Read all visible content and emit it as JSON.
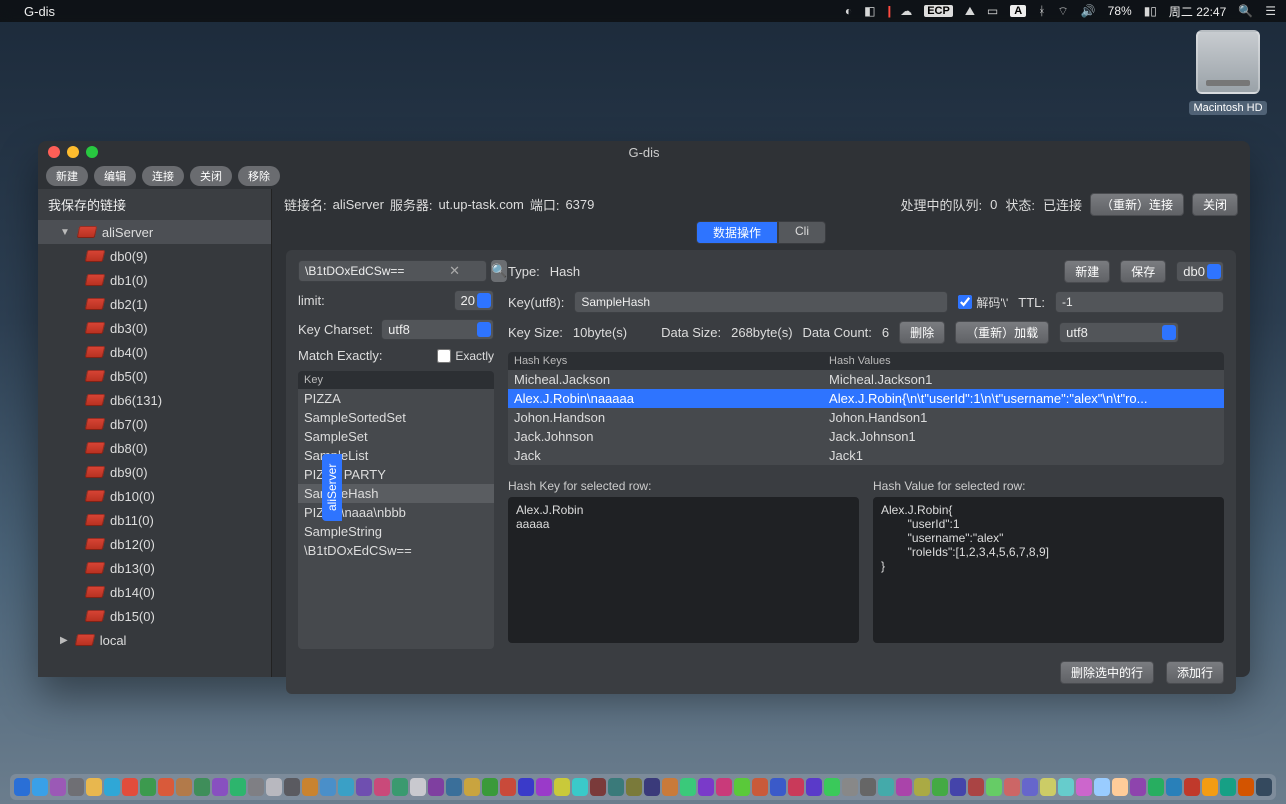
{
  "menubar": {
    "app_name": "G-dis",
    "battery_pct": "78%",
    "clock": "周二 22:47"
  },
  "desktop": {
    "hdd_label": "Macintosh HD"
  },
  "window": {
    "title": "G-dis",
    "toolbar": {
      "new": "新建",
      "edit": "编辑",
      "connect": "连接",
      "close": "关闭",
      "remove": "移除"
    },
    "info": {
      "conn_name_label": "链接名:",
      "conn_name": "aliServer",
      "server_label": "服务器:",
      "server": "ut.up-task.com",
      "port_label": "端口:",
      "port": "6379",
      "queue_label": "处理中的队列:",
      "queue_val": "0",
      "status_label": "状态:",
      "status_val": "已连接",
      "reconnect": "（重新）连接",
      "close": "关闭"
    }
  },
  "sidebar": {
    "header": "我保存的链接",
    "server": "aliServer",
    "local": "local",
    "dbs": [
      {
        "label": "db0(9)"
      },
      {
        "label": "db1(0)"
      },
      {
        "label": "db2(1)"
      },
      {
        "label": "db3(0)"
      },
      {
        "label": "db4(0)"
      },
      {
        "label": "db5(0)"
      },
      {
        "label": "db6(131)"
      },
      {
        "label": "db7(0)"
      },
      {
        "label": "db8(0)"
      },
      {
        "label": "db9(0)"
      },
      {
        "label": "db10(0)"
      },
      {
        "label": "db11(0)"
      },
      {
        "label": "db12(0)"
      },
      {
        "label": "db13(0)"
      },
      {
        "label": "db14(0)"
      },
      {
        "label": "db15(0)"
      }
    ]
  },
  "tabs": {
    "data": "数据操作",
    "cli": "Cli"
  },
  "left_panel": {
    "search_value": "\\B1tDOxEdCSw==",
    "limit_label": "limit:",
    "limit_value": "20",
    "charset_label": "Key Charset:",
    "charset_value": "utf8",
    "match_label": "Match Exactly:",
    "exactly_label": "Exactly",
    "keys_header": "Key",
    "keys": [
      "PIZZA",
      "SampleSortedSet",
      "SampleSet",
      "SampleList",
      "PIZZA PARTY",
      "SampleHash",
      "PIZZA\\naaa\\nbbb",
      "SampleString",
      "\\B1tDOxEdCSw=="
    ],
    "selected_key": "SampleHash"
  },
  "right_panel": {
    "type_label": "Type:",
    "type_value": "Hash",
    "btn_new": "新建",
    "btn_save": "保存",
    "db_sel": "db0",
    "key_label": "Key(utf8):",
    "key_value": "SampleHash",
    "decode_label": "解码'\\'",
    "ttl_label": "TTL:",
    "ttl_value": "-1",
    "size_label": "Key Size:",
    "size_value": "10byte(s)",
    "data_size_label": "Data Size:",
    "data_size_value": "268byte(s)",
    "data_count_label": "Data Count:",
    "data_count_value": "6",
    "btn_delete": "删除",
    "btn_reload": "（重新）加载",
    "enc_sel": "utf8",
    "hash_keys_header": "Hash Keys",
    "hash_values_header": "Hash Values",
    "rows": [
      {
        "k": "Micheal.Jackson",
        "v": "Micheal.Jackson1"
      },
      {
        "k": "Alex.J.Robin\\naaaaa",
        "v": "Alex.J.Robin{\\n\\t\"userId\":1\\n\\t\"username\":\"alex\"\\n\\t\"ro..."
      },
      {
        "k": "Johon.Handson",
        "v": "Johon.Handson1"
      },
      {
        "k": "Jack.Johnson",
        "v": "Jack.Johnson1"
      },
      {
        "k": "Jack",
        "v": "Jack1"
      }
    ],
    "selected_row_index": 1,
    "sel_key_label": "Hash Key for selected row:",
    "sel_val_label": "Hash Value for selected row:",
    "sel_key_text": "Alex.J.Robin\naaaaa",
    "sel_val_text": "Alex.J.Robin{\n        \"userId\":1\n        \"username\":\"alex\"\n        \"roleIds\":[1,2,3,4,5,6,7,8,9]\n}",
    "btn_del_row": "删除选中的行",
    "btn_add_row": "添加行"
  },
  "vtab": "aliServer",
  "dock_colors": [
    "#2a6fd6",
    "#39a0e8",
    "#9b59b6",
    "#6f6f74",
    "#e8b74e",
    "#2fa7d6",
    "#e24c3c",
    "#3c9a4e",
    "#d95a3a",
    "#b27a4a",
    "#3f8e5a",
    "#8850c0",
    "#2db56d",
    "#7f7f84",
    "#b8b8bf",
    "#5a5a60",
    "#c9832f",
    "#4a8fc9",
    "#3aa0c6",
    "#6f4fb0",
    "#c94a7a",
    "#3a9a6f",
    "#c9c9cf",
    "#7f3fa0",
    "#3a6f9a",
    "#c9a43f",
    "#3a9a3a",
    "#c94a3a",
    "#3a3ac9",
    "#9a3ac9",
    "#c9c93a",
    "#3ac9c9",
    "#7a3a3a",
    "#3a7a7a",
    "#7a7a3a",
    "#3a3a7a",
    "#c97a3a",
    "#3ac97a",
    "#7a3ac9",
    "#c93a7a",
    "#5ac93a",
    "#c95a3a",
    "#3a5ac9",
    "#c93a5a",
    "#5a3ac9",
    "#3ac95a",
    "#888",
    "#666",
    "#4aa",
    "#a4a",
    "#aa4",
    "#4a4",
    "#44a",
    "#a44",
    "#6c6",
    "#c66",
    "#66c",
    "#cc6",
    "#6cc",
    "#c6c",
    "#9cf",
    "#fc9",
    "#8e44ad",
    "#27ae60",
    "#2980b9",
    "#c0392b",
    "#f39c12",
    "#16a085",
    "#d35400",
    "#34495e"
  ]
}
